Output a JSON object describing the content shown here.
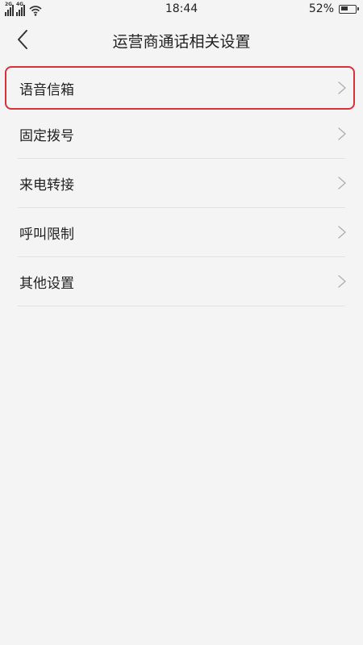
{
  "status_bar": {
    "signal_1_tag": "2G",
    "signal_2_tag": "4G",
    "time": "18:44",
    "battery_percent": "52%",
    "battery_level": 0.52,
    "wifi_icon": "wifi-icon",
    "battery_icon": "battery-icon"
  },
  "header": {
    "back_icon": "chevron-left-icon",
    "title": "运营商通话相关设置"
  },
  "menu": {
    "items": [
      {
        "label": "语音信箱",
        "icon": "chevron-right-icon",
        "highlighted": true
      },
      {
        "label": "固定拨号",
        "icon": "chevron-right-icon"
      },
      {
        "label": "来电转接",
        "icon": "chevron-right-icon"
      },
      {
        "label": "呼叫限制",
        "icon": "chevron-right-icon"
      },
      {
        "label": "其他设置",
        "icon": "chevron-right-icon"
      }
    ]
  },
  "colors": {
    "background": "#f4f4f4",
    "text": "#222222",
    "divider": "#e2e2e2",
    "chevron": "#b0b0b0",
    "highlight": "#d8313a"
  }
}
